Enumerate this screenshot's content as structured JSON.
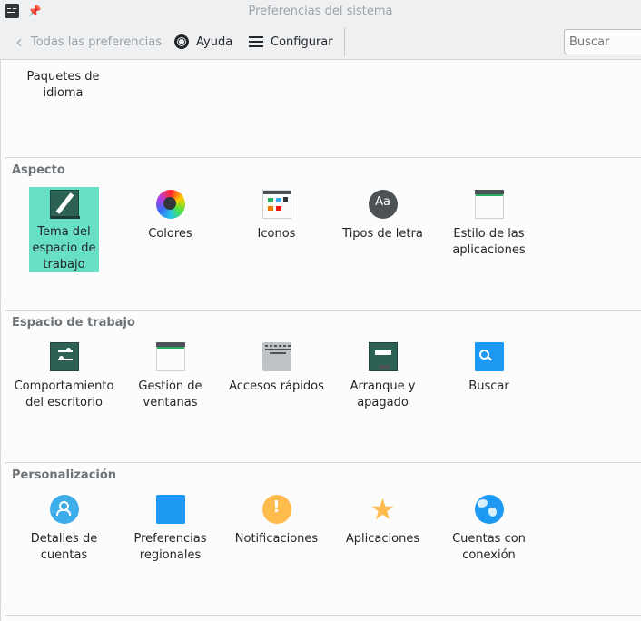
{
  "window": {
    "title": "Preferencias del sistema"
  },
  "toolbar": {
    "back_label": "Todas las preferencias",
    "help_label": "Ayuda",
    "config_label": "Configurar",
    "search_placeholder": "Buscar"
  },
  "partial_group": {
    "items": [
      {
        "label": "Paquetes de idioma",
        "icon": "language-packages-icon"
      }
    ]
  },
  "groups": [
    {
      "title": "Aspecto",
      "items": [
        {
          "label": "Tema del espacio de trabajo",
          "icon": "workspace-theme-icon",
          "selected": true
        },
        {
          "label": "Colores",
          "icon": "color-wheel-icon"
        },
        {
          "label": "Iconos",
          "icon": "icons-window-icon"
        },
        {
          "label": "Tipos de letra",
          "icon": "font-icon"
        },
        {
          "label": "Estilo de las aplicaciones",
          "icon": "app-style-window-icon"
        }
      ]
    },
    {
      "title": "Espacio de trabajo",
      "items": [
        {
          "label": "Comportamiento del escritorio",
          "icon": "desktop-behavior-icon"
        },
        {
          "label": "Gestión de ventanas",
          "icon": "window-management-icon"
        },
        {
          "label": "Accesos rápidos",
          "icon": "keyboard-icon"
        },
        {
          "label": "Arranque y apagado",
          "icon": "monitor-icon"
        },
        {
          "label": "Buscar",
          "icon": "search-document-icon"
        }
      ]
    },
    {
      "title": "Personalización",
      "items": [
        {
          "label": "Detalles de cuentas",
          "icon": "user-account-icon"
        },
        {
          "label": "Preferencias regionales",
          "icon": "speech-bubble-icon"
        },
        {
          "label": "Notificaciones",
          "icon": "notification-icon"
        },
        {
          "label": "Aplicaciones",
          "icon": "star-icon"
        },
        {
          "label": "Cuentas con conexión",
          "icon": "globe-icon"
        }
      ]
    }
  ],
  "colors": {
    "selection": "#67e0c5",
    "accent": "#1d99f3"
  }
}
